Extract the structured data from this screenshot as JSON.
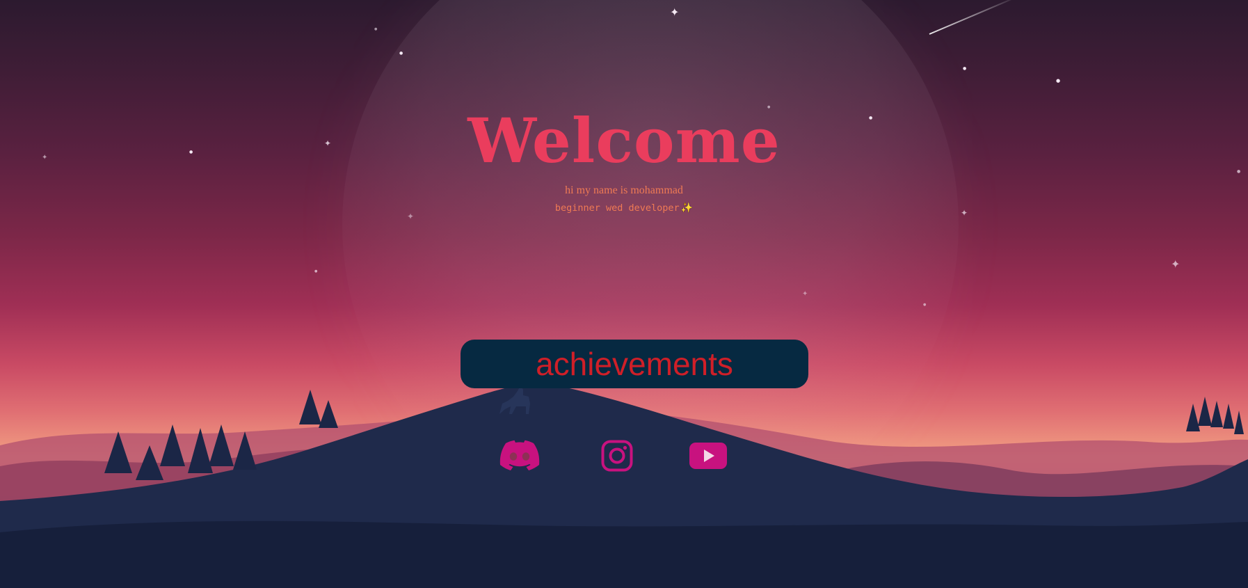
{
  "hero": {
    "title": "Welcome",
    "subtitle": "hi my name is mohammad",
    "role": "beginner wed developer",
    "sparkle": "✨"
  },
  "actions": {
    "achievements_label": "achievements"
  },
  "social": {
    "icons": [
      "discord-icon",
      "instagram-icon",
      "youtube-icon"
    ],
    "color": "#c8127f"
  },
  "colors": {
    "title": "#ea3d5d",
    "subtitle": "#ef7a54",
    "button_bg": "#062941",
    "button_text": "#cf1f28"
  }
}
